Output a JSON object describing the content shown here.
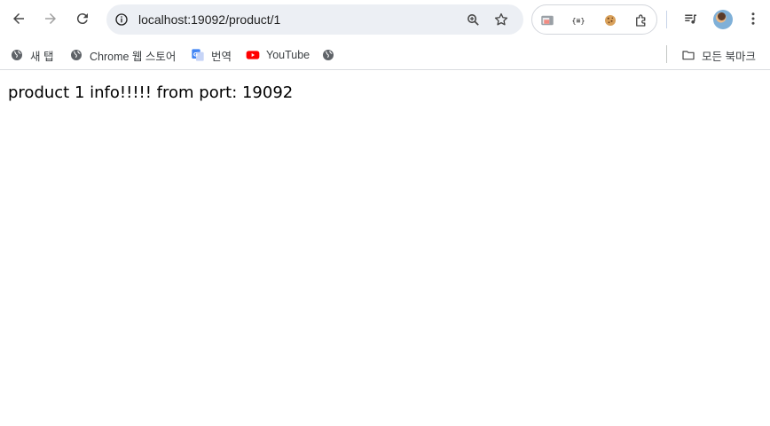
{
  "toolbar": {
    "back_icon": "arrow-left-icon",
    "forward_icon": "arrow-right-icon",
    "reload_icon": "reload-icon",
    "menu_icon": "more-vertical-icon"
  },
  "omnibox": {
    "url": "localhost:19092/product/1",
    "site_info_icon": "info-icon",
    "zoom_icon": "zoom-icon",
    "bookmark_icon": "star-icon"
  },
  "extensions": [
    {
      "name": "screenshot-extension-icon"
    },
    {
      "name": "json-formatter-icon"
    },
    {
      "name": "cookie-icon"
    },
    {
      "name": "puzzle-icon"
    }
  ],
  "bookmarks_bar": {
    "items": [
      {
        "label": "새 탭",
        "icon": "globe-icon"
      },
      {
        "label": "Chrome 웹 스토어",
        "icon": "globe-icon"
      },
      {
        "label": "번역",
        "icon": "translate-icon"
      },
      {
        "label": "YouTube",
        "icon": "youtube-icon"
      },
      {
        "label": "",
        "icon": "globe-icon"
      }
    ],
    "all_bookmarks_label": "모든 북마크"
  },
  "page": {
    "text": "product 1 info!!!!! from port: 19092"
  },
  "colors": {
    "omnibox_bg": "#eceff4",
    "youtube_red": "#ff0000",
    "icon_gray": "#474747"
  }
}
